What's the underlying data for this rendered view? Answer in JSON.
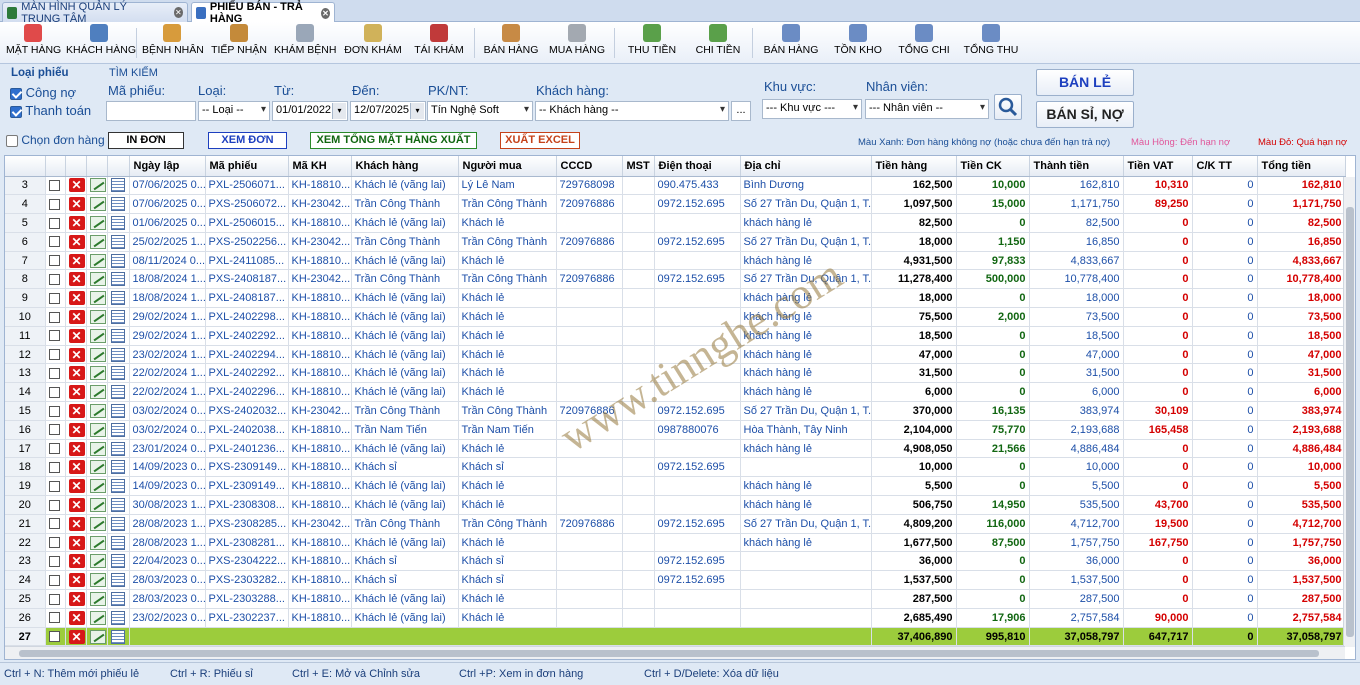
{
  "tabs": [
    {
      "label": "MÀN HÌNH QUẢN LÝ TRUNG TÂM",
      "active": false
    },
    {
      "label": "PHIẾU BÁN - TRẢ HÀNG",
      "active": true
    }
  ],
  "toolbar": [
    {
      "label": "MẶT HÀNG",
      "icon": "pen-icon"
    },
    {
      "label": "KHÁCH HÀNG",
      "icon": "customers-icon"
    },
    {
      "label": "BỆNH NHÂN",
      "icon": "patient-icon"
    },
    {
      "label": "TIẾP NHẬN",
      "icon": "reception-icon"
    },
    {
      "label": "KHÁM BỆNH",
      "icon": "doctor-icon"
    },
    {
      "label": "ĐƠN KHÁM",
      "icon": "prescription-icon"
    },
    {
      "label": "TÁI KHÁM",
      "icon": "calendar-icon"
    },
    {
      "label": "BÁN HÀNG",
      "icon": "register-icon"
    },
    {
      "label": "MUA HÀNG",
      "icon": "cart-icon"
    },
    {
      "label": "THU TIỀN",
      "icon": "money-in-icon"
    },
    {
      "label": "CHI TIỀN",
      "icon": "money-out-icon"
    },
    {
      "label": "BÁN HÀNG",
      "icon": "sales-report-icon"
    },
    {
      "label": "TỒN KHO",
      "icon": "stock-report-icon"
    },
    {
      "label": "TỔNG CHI",
      "icon": "expense-report-icon"
    },
    {
      "label": "TỔNG THU",
      "icon": "income-report-icon"
    }
  ],
  "filter": {
    "loai_phieu": "Loại phiếu",
    "tim_kiem": "TÌM KIẾM",
    "cong_no": "Công nợ",
    "thanh_toan": "Thanh toán",
    "ma_phieu_label": "Mã phiếu:",
    "ma_phieu_value": "",
    "loai_label": "Loại:",
    "loai_value": "-- Loại --",
    "tu_label": "Từ:",
    "tu_value": "01/01/2022",
    "den_label": "Đến:",
    "den_value": "12/07/2025",
    "pknt_label": "PK/NT:",
    "pknt_value": "Tín Nghệ Soft",
    "khach_hang_label": "Khách hàng:",
    "khach_hang_value": "-- Khách hàng --",
    "more_button": "...",
    "khu_vuc_label": "Khu vực:",
    "khu_vuc_value": "--- Khu vực ---",
    "nhan_vien_label": "Nhân viên:",
    "nhan_vien_value": "--- Nhân viên --",
    "ban_le": "BÁN LẺ",
    "ban_si_no": "BÁN SỈ, NỢ",
    "chon_don_hang": "Chọn đơn hàng",
    "in_don": "IN ĐƠN",
    "xem_don": "XEM ĐƠN",
    "xem_tong": "XEM TỔNG MẶT HÀNG XUẤT",
    "xuat_excel": "XUẤT EXCEL",
    "legend_xanh": "Màu Xanh: Đơn hàng không nợ (hoặc chưa đến hạn trả nợ)",
    "legend_hong": "Màu Hồng: Đến hạn nợ",
    "legend_do": "Màu Đỏ: Quá hạn nợ"
  },
  "columns": [
    "Ngày lập",
    "Mã phiếu",
    "Mã KH",
    "Khách hàng",
    "Người mua",
    "CCCD",
    "MST",
    "Điện thoại",
    "Địa chỉ",
    "Tiền hàng",
    "Tiền CK",
    "Thành tiền",
    "Tiền VAT",
    "C/K TT",
    "Tổng tiền"
  ],
  "rows": [
    [
      "3",
      "07/06/2025 0...",
      "PXL-2506071...",
      "KH-18810...",
      "Khách lẻ (vãng lai)",
      "Lý Lê Nam",
      "729768098",
      "",
      "090.475.433",
      "Bình Dương",
      "162,500",
      "10,000",
      "162,810",
      "10,310",
      "0",
      "162,810"
    ],
    [
      "4",
      "07/06/2025 0...",
      "PXS-2506072...",
      "KH-23042...",
      "Trần Công Thành",
      "Trần Công Thành",
      "720976886",
      "",
      "0972.152.695",
      "Số 27 Trần Du, Quận 1, T...",
      "1,097,500",
      "15,000",
      "1,171,750",
      "89,250",
      "0",
      "1,171,750"
    ],
    [
      "5",
      "01/06/2025 0...",
      "PXL-2506015...",
      "KH-18810...",
      "Khách lẻ (vãng lai)",
      "Khách lẻ",
      "",
      "",
      "",
      "khách hàng lẻ",
      "82,500",
      "0",
      "82,500",
      "0",
      "0",
      "82,500"
    ],
    [
      "6",
      "25/02/2025 1...",
      "PXS-2502256...",
      "KH-23042...",
      "Trần Công Thành",
      "Trần Công Thành",
      "720976886",
      "",
      "0972.152.695",
      "Số 27 Trần Du, Quận 1, T...",
      "18,000",
      "1,150",
      "16,850",
      "0",
      "0",
      "16,850"
    ],
    [
      "7",
      "08/11/2024 0...",
      "PXL-2411085...",
      "KH-18810...",
      "Khách lẻ (vãng lai)",
      "Khách lẻ",
      "",
      "",
      "",
      "khách hàng lẻ",
      "4,931,500",
      "97,833",
      "4,833,667",
      "0",
      "0",
      "4,833,667"
    ],
    [
      "8",
      "18/08/2024 1...",
      "PXS-2408187...",
      "KH-23042...",
      "Trần Công Thành",
      "Trần Công Thành",
      "720976886",
      "",
      "0972.152.695",
      "Số 27 Trần Du, Quận 1, T...",
      "11,278,400",
      "500,000",
      "10,778,400",
      "0",
      "0",
      "10,778,400"
    ],
    [
      "9",
      "18/08/2024 1...",
      "PXL-2408187...",
      "KH-18810...",
      "Khách lẻ (vãng lai)",
      "Khách lẻ",
      "",
      "",
      "",
      "khách hàng lẻ",
      "18,000",
      "0",
      "18,000",
      "0",
      "0",
      "18,000"
    ],
    [
      "10",
      "29/02/2024 1...",
      "PXL-2402298...",
      "KH-18810...",
      "Khách lẻ (vãng lai)",
      "Khách lẻ",
      "",
      "",
      "",
      "khách hàng lẻ",
      "75,500",
      "2,000",
      "73,500",
      "0",
      "0",
      "73,500"
    ],
    [
      "11",
      "29/02/2024 1...",
      "PXL-2402292...",
      "KH-18810...",
      "Khách lẻ (vãng lai)",
      "Khách lẻ",
      "",
      "",
      "",
      "khách hàng lẻ",
      "18,500",
      "0",
      "18,500",
      "0",
      "0",
      "18,500"
    ],
    [
      "12",
      "23/02/2024 1...",
      "PXL-2402294...",
      "KH-18810...",
      "Khách lẻ (vãng lai)",
      "Khách lẻ",
      "",
      "",
      "",
      "khách hàng lẻ",
      "47,000",
      "0",
      "47,000",
      "0",
      "0",
      "47,000"
    ],
    [
      "13",
      "22/02/2024 1...",
      "PXL-2402292...",
      "KH-18810...",
      "Khách lẻ (vãng lai)",
      "Khách lẻ",
      "",
      "",
      "",
      "khách hàng lẻ",
      "31,500",
      "0",
      "31,500",
      "0",
      "0",
      "31,500"
    ],
    [
      "14",
      "22/02/2024 1...",
      "PXL-2402296...",
      "KH-18810...",
      "Khách lẻ (vãng lai)",
      "Khách lẻ",
      "",
      "",
      "",
      "khách hàng lẻ",
      "6,000",
      "0",
      "6,000",
      "0",
      "0",
      "6,000"
    ],
    [
      "15",
      "03/02/2024 0...",
      "PXS-2402032...",
      "KH-23042...",
      "Trần Công Thành",
      "Trần Công Thành",
      "720976886",
      "",
      "0972.152.695",
      "Số 27 Trần Du, Quận 1, T...",
      "370,000",
      "16,135",
      "383,974",
      "30,109",
      "0",
      "383,974"
    ],
    [
      "16",
      "03/02/2024 0...",
      "PXL-2402038...",
      "KH-18810...",
      "Trần Nam Tiến",
      "Trần Nam Tiến",
      "",
      "",
      "0987880076",
      "Hòa Thành, Tây Ninh",
      "2,104,000",
      "75,770",
      "2,193,688",
      "165,458",
      "0",
      "2,193,688"
    ],
    [
      "17",
      "23/01/2024 0...",
      "PXL-2401236...",
      "KH-18810...",
      "Khách lẻ (vãng lai)",
      "Khách lẻ",
      "",
      "",
      "",
      "khách hàng lẻ",
      "4,908,050",
      "21,566",
      "4,886,484",
      "0",
      "0",
      "4,886,484"
    ],
    [
      "18",
      "14/09/2023 0...",
      "PXS-2309149...",
      "KH-18810...",
      "Khách sỉ",
      "Khách sỉ",
      "",
      "",
      "0972.152.695",
      "",
      "10,000",
      "0",
      "10,000",
      "0",
      "0",
      "10,000"
    ],
    [
      "19",
      "14/09/2023 0...",
      "PXL-2309149...",
      "KH-18810...",
      "Khách lẻ (vãng lai)",
      "Khách lẻ",
      "",
      "",
      "",
      "khách hàng lẻ",
      "5,500",
      "0",
      "5,500",
      "0",
      "0",
      "5,500"
    ],
    [
      "20",
      "30/08/2023 1...",
      "PXL-2308308...",
      "KH-18810...",
      "Khách lẻ (vãng lai)",
      "Khách lẻ",
      "",
      "",
      "",
      "khách hàng lẻ",
      "506,750",
      "14,950",
      "535,500",
      "43,700",
      "0",
      "535,500"
    ],
    [
      "21",
      "28/08/2023 1...",
      "PXS-2308285...",
      "KH-23042...",
      "Trần Công Thành",
      "Trần Công Thành",
      "720976886",
      "",
      "0972.152.695",
      "Số 27 Trần Du, Quận 1, T...",
      "4,809,200",
      "116,000",
      "4,712,700",
      "19,500",
      "0",
      "4,712,700"
    ],
    [
      "22",
      "28/08/2023 1...",
      "PXL-2308281...",
      "KH-18810...",
      "Khách lẻ (vãng lai)",
      "Khách lẻ",
      "",
      "",
      "",
      "khách hàng lẻ",
      "1,677,500",
      "87,500",
      "1,757,750",
      "167,750",
      "0",
      "1,757,750"
    ],
    [
      "23",
      "22/04/2023 0...",
      "PXS-2304222...",
      "KH-18810...",
      "Khách sỉ",
      "Khách sỉ",
      "",
      "",
      "0972.152.695",
      "",
      "36,000",
      "0",
      "36,000",
      "0",
      "0",
      "36,000"
    ],
    [
      "24",
      "28/03/2023 0...",
      "PXS-2303282...",
      "KH-18810...",
      "Khách sỉ",
      "Khách sỉ",
      "",
      "",
      "0972.152.695",
      "",
      "1,537,500",
      "0",
      "1,537,500",
      "0",
      "0",
      "1,537,500"
    ],
    [
      "25",
      "28/03/2023 0...",
      "PXL-2303288...",
      "KH-18810...",
      "Khách lẻ (vãng lai)",
      "Khách lẻ",
      "",
      "",
      "",
      "",
      "287,500",
      "0",
      "287,500",
      "0",
      "0",
      "287,500"
    ],
    [
      "26",
      "23/02/2023 0...",
      "PXL-2302237...",
      "KH-18810...",
      "Khách lẻ (vãng lai)",
      "Khách lẻ",
      "",
      "",
      "",
      "",
      "2,685,490",
      "17,906",
      "2,757,584",
      "90,000",
      "0",
      "2,757,584"
    ]
  ],
  "total": {
    "rn": "27",
    "tien_hang": "37,406,890",
    "tien_ck": "995,810",
    "thanh_tien": "37,058,797",
    "tien_vat": "647,717",
    "ck_tt": "0",
    "tong_tien": "37,058,797"
  },
  "watermark": "www.tinnghe.com",
  "status": {
    "s1": "Ctrl + N: Thêm mới phiếu lẻ",
    "s2": "Ctrl + R: Phiếu sỉ",
    "s3": "Ctrl + E:  Mở và Chỉnh sửa",
    "s4": "Ctrl +P:  Xem in đơn hàng",
    "s5": "Ctrl + D/Delete:  Xóa dữ liệu"
  },
  "colors": {
    "accent": "#1d4fa8",
    "total_row": "#9ccc3c",
    "debt_red": "#d40000"
  }
}
